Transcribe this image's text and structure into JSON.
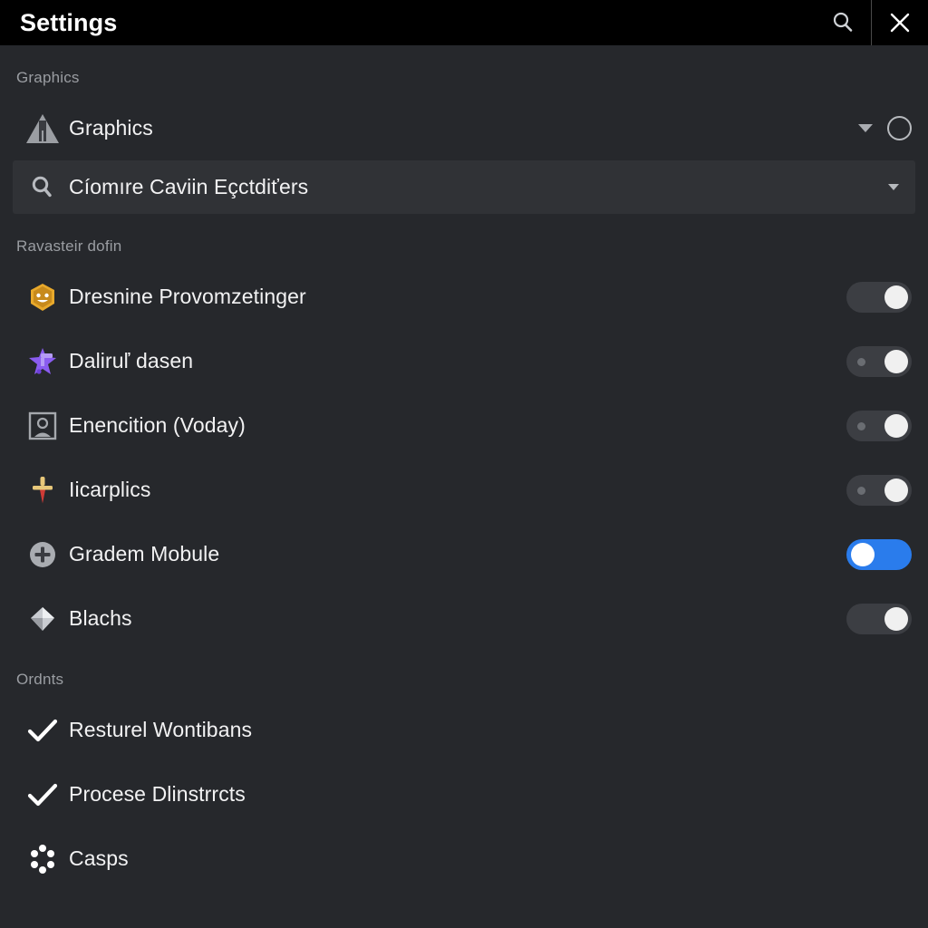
{
  "window": {
    "title": "Settings",
    "search_icon": "search-icon",
    "close_icon": "close-icon"
  },
  "sections": [
    {
      "id": "graphics",
      "header": "Graphics",
      "rows": [
        {
          "id": "graphics-row",
          "label": "Graphics",
          "icon": "triangle-a-icon",
          "control": "caret-and-radio",
          "caret": "chevron-down-icon",
          "radio": "radio-unselected"
        },
        {
          "id": "search-dropdown",
          "label": "Cíomıre Caviin Eçctdiťers",
          "icon": "search-icon",
          "control": "dropdown",
          "caret": "chevron-down-icon",
          "banded": true
        }
      ]
    },
    {
      "id": "ravasteir",
      "header": "Ravasteir dofin",
      "rows": [
        {
          "id": "dresnine",
          "label": "Dresnine Provomzetinger",
          "icon": "gold-hex-badge-icon",
          "control": "toggle",
          "toggle_on": false,
          "toggle_dot": false
        },
        {
          "id": "daliru",
          "label": "Daliruľ dasen",
          "icon": "purple-star-icon",
          "control": "toggle",
          "toggle_on": false,
          "toggle_dot": true
        },
        {
          "id": "enencition",
          "label": "Enencition (Voday)",
          "icon": "portrait-frame-icon",
          "control": "toggle",
          "toggle_on": false,
          "toggle_dot": true
        },
        {
          "id": "iicarplics",
          "label": "Iicarplics",
          "icon": "dagger-icon",
          "control": "toggle",
          "toggle_on": false,
          "toggle_dot": true
        },
        {
          "id": "gradem",
          "label": "Gradem Mobule",
          "icon": "plus-circle-icon",
          "control": "toggle",
          "toggle_on": true,
          "toggle_dot": false
        },
        {
          "id": "blachs",
          "label": "Blachs",
          "icon": "silver-gem-icon",
          "control": "toggle",
          "toggle_on": false,
          "toggle_dot": false
        }
      ]
    },
    {
      "id": "ordnts",
      "header": "Ordnts",
      "rows": [
        {
          "id": "resturel",
          "label": "Resturel Wontibans",
          "icon": "check-icon",
          "control": "none"
        },
        {
          "id": "procese",
          "label": "Procese Dlinstrrcts",
          "icon": "check-icon",
          "control": "none"
        },
        {
          "id": "casps",
          "label": "Casps",
          "icon": "spinner-dots-icon",
          "control": "none"
        }
      ]
    }
  ],
  "colors": {
    "accent": "#2a7cec",
    "background": "#26282c",
    "titlebar": "#000000",
    "band": "#303236",
    "muted_text": "#9a9da2"
  }
}
